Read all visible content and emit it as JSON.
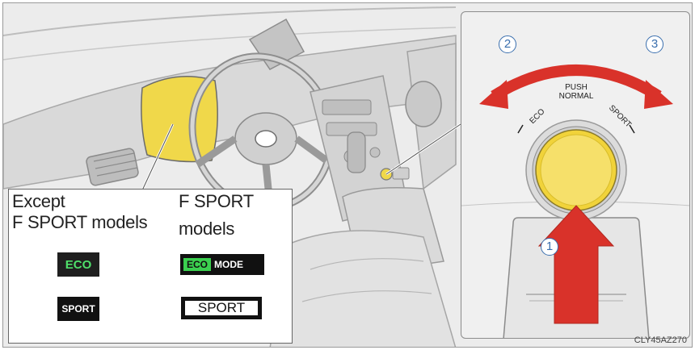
{
  "legend": {
    "standard_heading_line1": "Except",
    "standard_heading_line2": "F SPORT models",
    "fsport_heading_line1": "F SPORT",
    "fsport_heading_line2": "models",
    "standard_eco": "ECO",
    "standard_sport": "SPORT",
    "fsport_eco_chip": "ECO",
    "fsport_eco_mode": "MODE",
    "fsport_sport": "SPORT"
  },
  "dial": {
    "push_label": "PUSH",
    "normal_label": "NORMAL",
    "eco_label": "ECO",
    "sport_label": "SPORT",
    "step_1": "1",
    "step_2": "2",
    "step_3": "3"
  },
  "figure_code": "CLY45AZ270",
  "colors": {
    "highlight_yellow": "#f0d84a",
    "arrow_red": "#d9322a",
    "callout_blue": "#3a6fae",
    "eco_green": "#3bd04f"
  }
}
